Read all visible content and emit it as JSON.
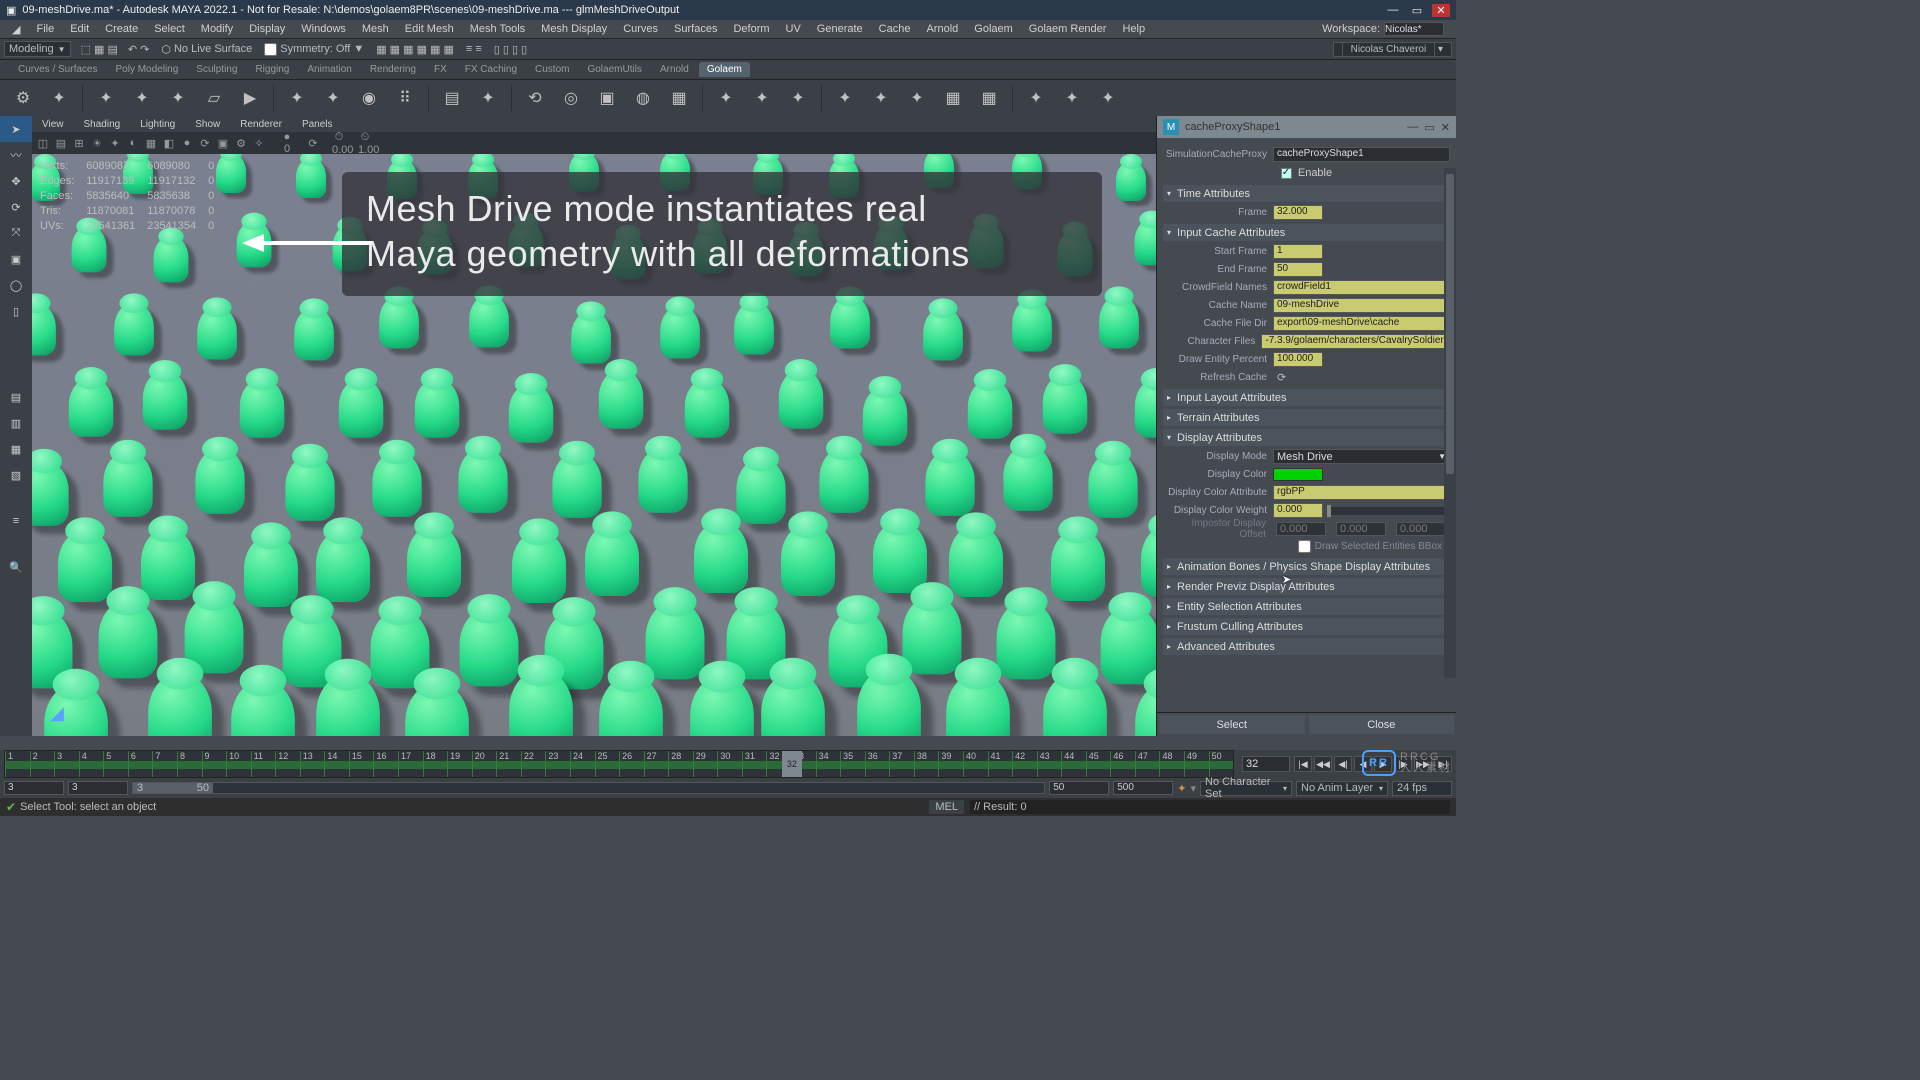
{
  "title": "09-meshDrive.ma* - Autodesk MAYA 2022.1 - Not for Resale: N:\\demos\\golaem8PR\\scenes\\09-meshDrive.ma --- glmMeshDriveOutput",
  "menu": [
    "File",
    "Edit",
    "Create",
    "Select",
    "Modify",
    "Display",
    "Windows",
    "Mesh",
    "Edit Mesh",
    "Mesh Tools",
    "Mesh Display",
    "Curves",
    "Surfaces",
    "Deform",
    "UV",
    "Generate",
    "Cache",
    "Arnold",
    "Golaem",
    "Golaem Render",
    "Help"
  ],
  "workspace_label": "Workspace:",
  "workspace_value": "Nicolas*",
  "mode": "Modeling",
  "no_live": "No Live Surface",
  "symmetry": "Symmetry: Off",
  "account": "Nicolas Chaveroi",
  "shelf_tabs": [
    "Curves / Surfaces",
    "Poly Modeling",
    "Sculpting",
    "Rigging",
    "Animation",
    "Rendering",
    "FX",
    "FX Caching",
    "Custom",
    "GolaemUtils",
    "Arnold",
    "Golaem"
  ],
  "active_shelf": "Golaem",
  "vp_menus": [
    "View",
    "Shading",
    "Lighting",
    "Show",
    "Renderer",
    "Panels"
  ],
  "stats": [
    [
      "Verts:",
      "6089087",
      "6089080",
      "0"
    ],
    [
      "Edges:",
      "11917139",
      "11917132",
      "0"
    ],
    [
      "Faces:",
      "5835640",
      "5835638",
      "0"
    ],
    [
      "Tris:",
      "11870081",
      "11870078",
      "0"
    ],
    [
      "UVs:",
      "23541361",
      "23541354",
      "0"
    ]
  ],
  "caption_l1": "Mesh Drive mode instantiates real",
  "caption_l2": "Maya geometry with all deformations",
  "panel": {
    "title": "cacheProxyShape1",
    "proxy_label": "SimulationCacheProxy",
    "proxy_value": "cacheProxyShape1",
    "enable": "Enable",
    "time_sect": "Time Attributes",
    "frame_lbl": "Frame",
    "frame": "32.000",
    "input_sect": "Input Cache Attributes",
    "start_lbl": "Start Frame",
    "start": "1",
    "end_lbl": "End Frame",
    "end": "50",
    "crowd_lbl": "CrowdField Names",
    "crowd": "crowdField1",
    "cachen_lbl": "Cache Name",
    "cachen": "09-meshDrive",
    "cached_lbl": "Cache File Dir",
    "cached": "export\\09-meshDrive\\cache",
    "char_lbl": "Character Files",
    "char": "-7.3.9/golaem/characters/CavalrySoldier.",
    "dep_lbl": "Draw Entity Percent",
    "dep": "100.000",
    "refresh_lbl": "Refresh Cache",
    "layout_sect": "Input Layout Attributes",
    "terrain_sect": "Terrain Attributes",
    "display_sect": "Display Attributes",
    "dmode_lbl": "Display Mode",
    "dmode": "Mesh Drive",
    "dcolor_lbl": "Display Color",
    "dcattr_lbl": "Display Color Attribute",
    "dcattr": "rgbPP",
    "dcw_lbl": "Display Color Weight",
    "dcw": "0.000",
    "impostor_lbl": "Impostor Display Offset",
    "impostor": [
      "0.000",
      "0.000",
      "0.000"
    ],
    "draw_bbox": "Draw Selected Entities BBox",
    "anim_sect": "Animation Bones / Physics Shape Display Attributes",
    "render_sect": "Render Previz Display Attributes",
    "entity_sect": "Entity Selection Attributes",
    "frustum_sect": "Frustum Culling Attributes",
    "advanced_sect": "Advanced Attributes",
    "select": "Select",
    "close": "Close"
  },
  "time": {
    "frames": [
      1,
      2,
      3,
      4,
      5,
      6,
      7,
      8,
      9,
      10,
      11,
      12,
      13,
      14,
      15,
      16,
      17,
      18,
      19,
      20,
      21,
      22,
      23,
      24,
      25,
      26,
      27,
      28,
      29,
      30,
      31,
      32,
      33,
      34,
      35,
      36,
      37,
      38,
      39,
      40,
      41,
      42,
      43,
      44,
      45,
      46,
      47,
      48,
      49,
      50
    ],
    "current": 32,
    "current_box": "32"
  },
  "range": {
    "a": "3",
    "b": "3",
    "c": "3",
    "d": "50",
    "e": "50",
    "f": "500",
    "charset": "No Character Set",
    "animlayer": "No Anim Layer",
    "fps": "24 fps"
  },
  "status": {
    "tool": "Select Tool: select an object",
    "mel": "MEL",
    "result": "// Result: 0"
  },
  "watermark": "RRCG\n人人素材"
}
